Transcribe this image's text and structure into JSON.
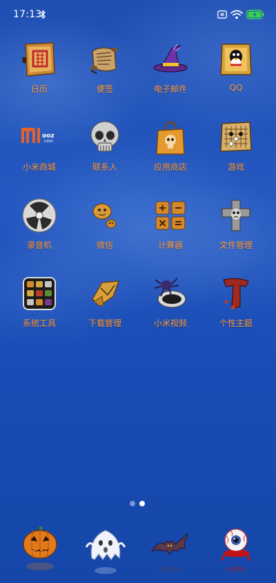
{
  "status_bar": {
    "time": "17:13",
    "icons": [
      "bluetooth-icon",
      "sim-card-icon",
      "wifi-icon",
      "battery-charging-icon"
    ],
    "battery_color": "#39d353"
  },
  "apps": [
    {
      "label": "日历",
      "icon": "calendar-icon"
    },
    {
      "label": "便签",
      "icon": "notes-scroll-icon"
    },
    {
      "label": "电子邮件",
      "icon": "witch-hat-icon"
    },
    {
      "label": "QQ",
      "icon": "qq-penguin-icon"
    },
    {
      "label": "小米商城",
      "icon": "mi-store-icon"
    },
    {
      "label": "联系人",
      "icon": "skull-icon"
    },
    {
      "label": "应用商店",
      "icon": "shopping-bag-icon"
    },
    {
      "label": "游戏",
      "icon": "game-board-icon"
    },
    {
      "label": "录音机",
      "icon": "tape-reel-icon"
    },
    {
      "label": "微信",
      "icon": "pumpkin-chat-icon"
    },
    {
      "label": "计算器",
      "icon": "calculator-tiles-icon"
    },
    {
      "label": "文件管理",
      "icon": "tombstone-icon"
    },
    {
      "label": "系统工具",
      "icon": "toolbox-icon"
    },
    {
      "label": "下载管理",
      "icon": "download-broken-icon"
    },
    {
      "label": "小米视频",
      "icon": "spider-video-icon"
    },
    {
      "label": "个性主题",
      "icon": "bloody-t-icon"
    }
  ],
  "label_color": "#ff9a3c",
  "page_indicator": {
    "pages": 2,
    "current": 2
  },
  "dock": [
    {
      "icon": "jack-o-lantern-icon"
    },
    {
      "icon": "ghost-icon"
    },
    {
      "icon": "bat-icon"
    },
    {
      "icon": "eyeball-icon"
    }
  ]
}
